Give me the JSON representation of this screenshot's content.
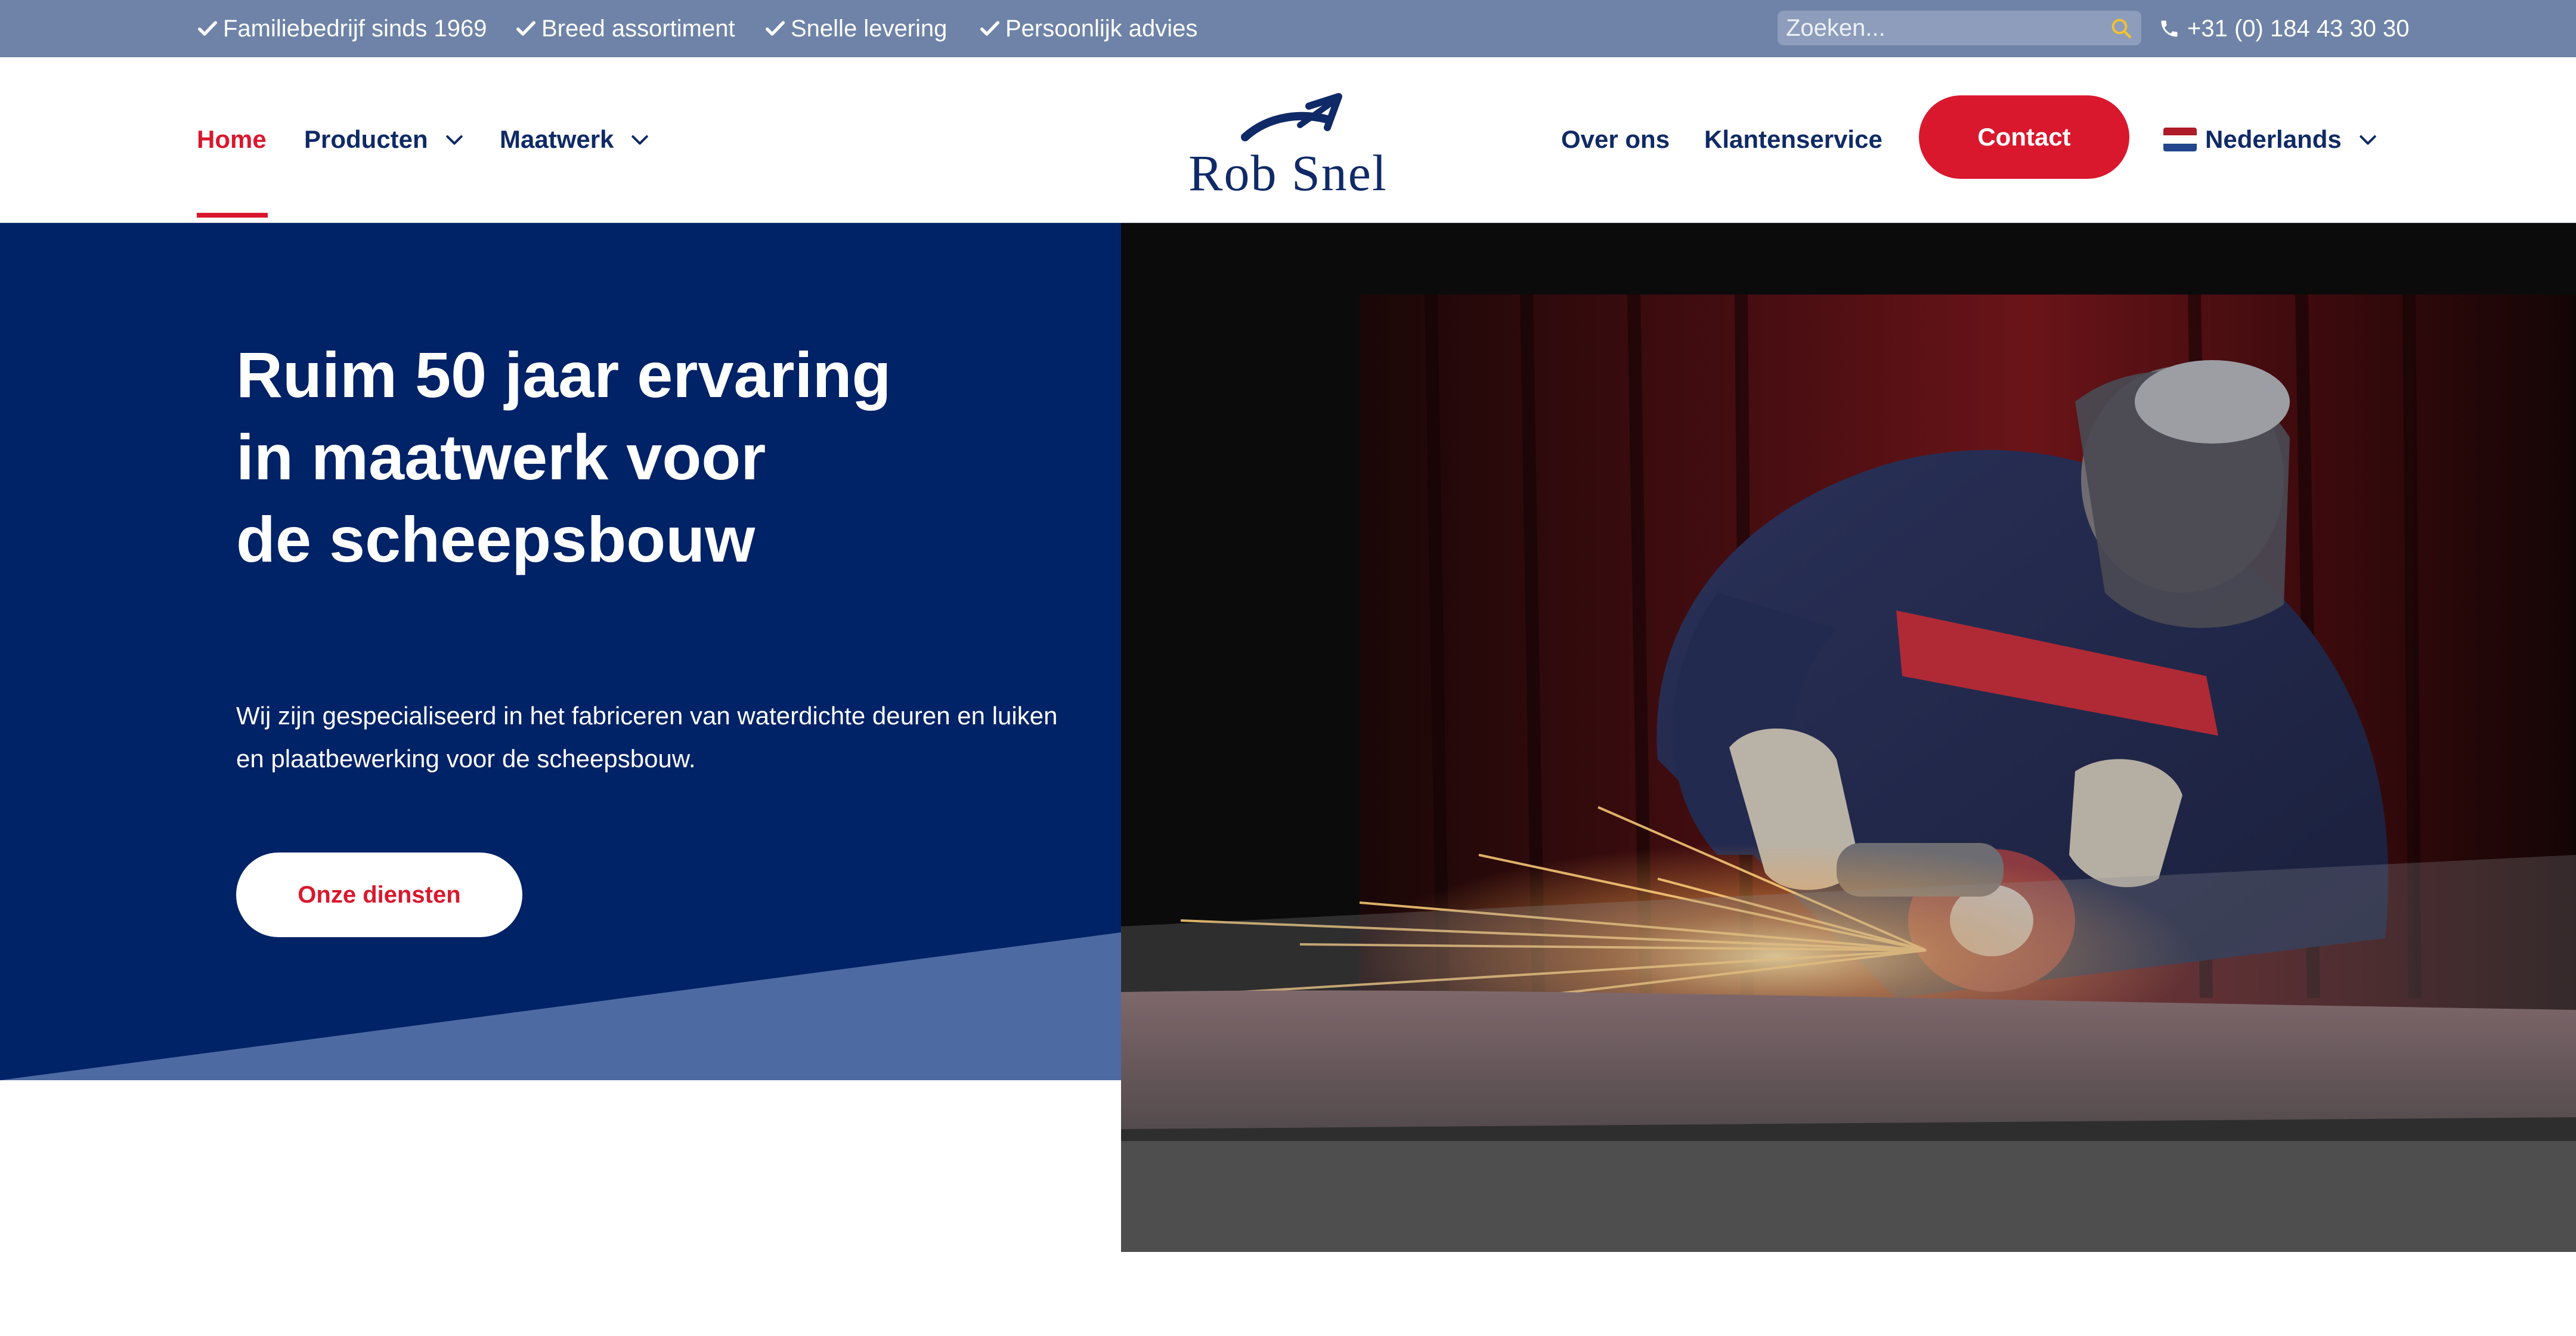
{
  "topbar": {
    "usps": [
      "Familiebedrijf sinds 1969",
      "Breed assortiment",
      "Snelle levering",
      "Persoonlijk advies"
    ],
    "search_placeholder": "Zoeken...",
    "phone": "+31 (0) 184 43 30 30"
  },
  "brand": {
    "name": "Rob Snel"
  },
  "nav": {
    "home": "Home",
    "producten": "Producten",
    "maatwerk": "Maatwerk",
    "over_ons": "Over ons",
    "klantenservice": "Klantenservice",
    "contact": "Contact",
    "language": "Nederlands"
  },
  "hero": {
    "title_lines": [
      "Ruim 50 jaar ervaring",
      "in maatwerk voor",
      "de scheepsbouw"
    ],
    "description": "Wij zijn gespecialiseerd in het fabriceren van waterdichte deuren en luiken en plaatbewerking voor de scheepsbouw.",
    "cta": "Onze diensten"
  },
  "colors": {
    "topbar": "#6e83a7",
    "navy": "#002266",
    "accent_red": "#d9182e",
    "hero_stripe": "#4e6aa3"
  }
}
